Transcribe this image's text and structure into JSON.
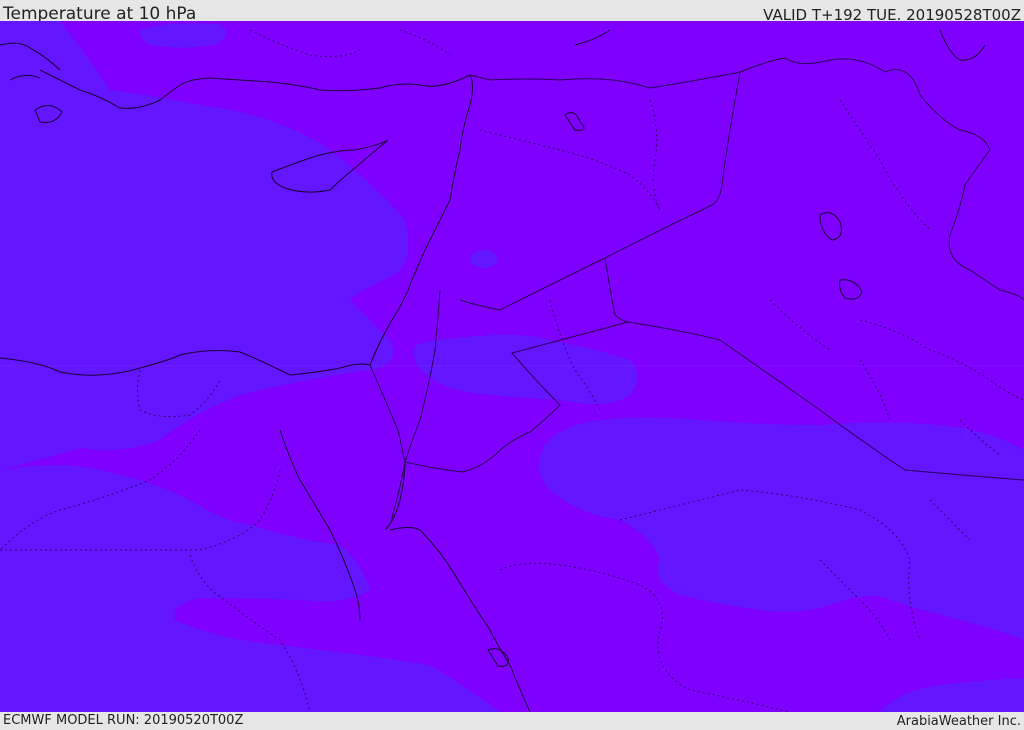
{
  "header": {
    "title": "Temperature at 10 hPa",
    "valid": "VALID T+192 TUE. 20190528T00Z"
  },
  "footer": {
    "run": "ECMWF MODEL RUN: 20190520T00Z",
    "brand": "ArabiaWeather Inc."
  },
  "colors": {
    "warm_band": "#7f00ff",
    "cool_band": "#6316ff",
    "coastline": "#1a0033",
    "border": "#2a0055",
    "bar_background": "#e6e6e6"
  }
}
